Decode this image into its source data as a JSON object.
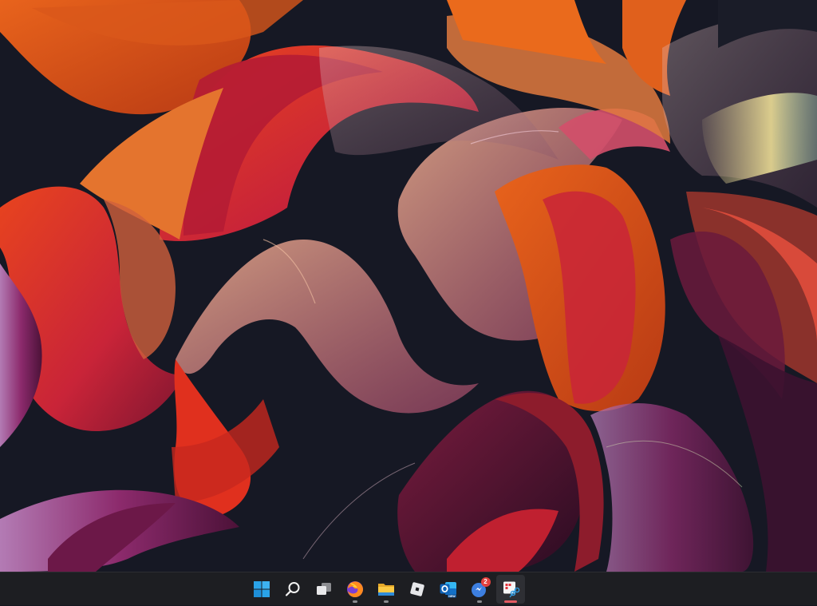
{
  "desktop": {
    "wallpaper": {
      "name": "abstract-ribbon-wallpaper",
      "colors": {
        "background": "#161824",
        "orange": "#e8631c",
        "deep_orange": "#d8441a",
        "red": "#c92438",
        "crimson": "#9b1836",
        "magenta": "#8c2a6c",
        "plum": "#5a1a44",
        "peach": "#e9a182",
        "lilac": "#b888b8"
      }
    }
  },
  "taskbar": {
    "background": "#1d1e22",
    "items": [
      {
        "name": "start-button",
        "icon": "windows-logo-icon",
        "running": false,
        "active": false
      },
      {
        "name": "search-button",
        "icon": "search-icon",
        "running": false,
        "active": false
      },
      {
        "name": "task-view-button",
        "icon": "task-view-icon",
        "running": false,
        "active": false
      },
      {
        "name": "firefox-button",
        "icon": "firefox-icon",
        "running": true,
        "active": false
      },
      {
        "name": "file-explorer-button",
        "icon": "folder-icon",
        "running": true,
        "active": false
      },
      {
        "name": "roblox-button",
        "icon": "roblox-icon",
        "running": false,
        "active": false
      },
      {
        "name": "outlook-new-button",
        "icon": "outlook-new-icon",
        "running": false,
        "active": false
      },
      {
        "name": "messenger-app-button",
        "icon": "chat-bubble-icon",
        "running": true,
        "active": false,
        "badge": "2"
      },
      {
        "name": "snipping-tool-button",
        "icon": "snipping-tool-icon",
        "running": true,
        "active": true
      }
    ]
  }
}
